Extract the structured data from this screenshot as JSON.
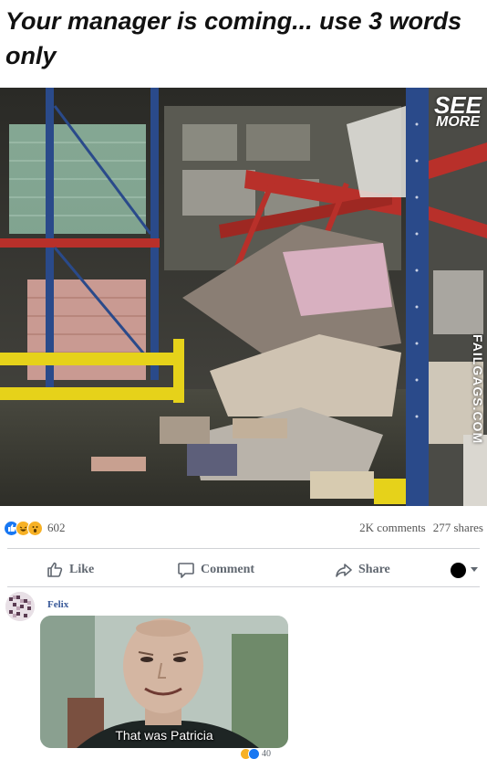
{
  "post": {
    "title": "Your manager is coming... use 3 words only",
    "image": {
      "description_alt": "collapsed-warehouse-shelving",
      "overlay_see": "SEE",
      "overlay_more": "MORE",
      "watermark": "FAILGAGS.COM"
    },
    "reactions": {
      "types": [
        "like",
        "haha",
        "wow"
      ],
      "count": "602"
    },
    "comments_count": "2K comments",
    "shares_count": "277 shares"
  },
  "actions": {
    "like_label": "Like",
    "comment_label": "Comment",
    "share_label": "Share"
  },
  "comment": {
    "author": "Felix",
    "meme_caption": "That was Patricia",
    "reactions": [
      "haha",
      "like"
    ],
    "reaction_count": "40"
  },
  "colors": {
    "facebook_blue": "#1877f2",
    "reaction_yellow": "#f7b125",
    "shelf_blue": "#2a4a8a",
    "shelf_red": "#b8302a",
    "safety_yellow": "#e6d21a"
  }
}
